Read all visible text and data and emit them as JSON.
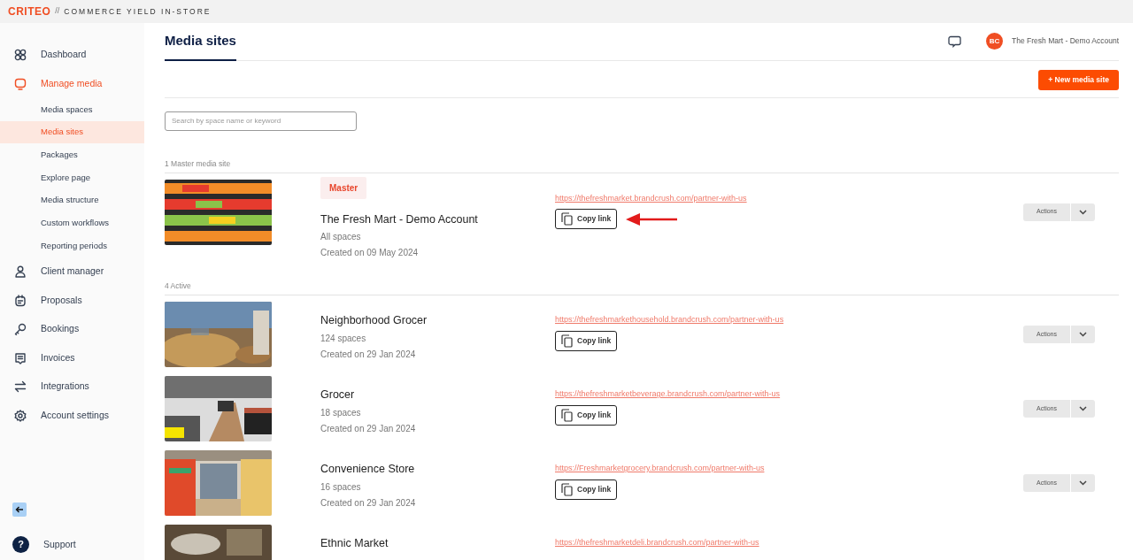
{
  "brand": {
    "logo": "CRITEO",
    "separator": "//",
    "product": "COMMERCE YIELD IN-STORE"
  },
  "sidebar": {
    "items": [
      {
        "label": "Dashboard",
        "selected": false
      },
      {
        "label": "Manage media",
        "selected": true,
        "children": [
          {
            "label": "Media spaces",
            "selected": false
          },
          {
            "label": "Media sites",
            "selected": true
          },
          {
            "label": "Packages",
            "selected": false
          },
          {
            "label": "Explore page",
            "selected": false
          },
          {
            "label": "Media structure",
            "selected": false
          },
          {
            "label": "Custom workflows",
            "selected": false
          },
          {
            "label": "Reporting periods",
            "selected": false
          }
        ]
      },
      {
        "label": "Client manager",
        "selected": false
      },
      {
        "label": "Proposals",
        "selected": false
      },
      {
        "label": "Bookings",
        "selected": false
      },
      {
        "label": "Invoices",
        "selected": false
      },
      {
        "label": "Integrations",
        "selected": false
      },
      {
        "label": "Account settings",
        "selected": false
      }
    ],
    "support": {
      "icon_text": "?",
      "label": "Support"
    }
  },
  "header": {
    "title": "Media sites",
    "user": {
      "initials": "BC",
      "name": "The Fresh Mart - Demo Account"
    }
  },
  "new_button": "+ New media site",
  "search": {
    "placeholder": "Search by space name or keyword"
  },
  "sections": [
    {
      "heading": "1 Master media site",
      "sites": [
        {
          "badge": "Master",
          "name": "The Fresh Mart - Demo Account",
          "spaces": "All spaces",
          "created": "Created on 09 May 2024",
          "url": "https://thefreshmarket.brandcrush.com/partner-with-us",
          "copy": "Copy link",
          "actions": "Actions",
          "arrow_annotation": true
        }
      ]
    },
    {
      "heading": "4 Active",
      "sites": [
        {
          "name": "Neighborhood Grocer",
          "spaces": "124 spaces",
          "created": "Created on 29 Jan 2024",
          "url": "https://thefreshmarkethousehold.brandcrush.com/partner-with-us",
          "copy": "Copy link",
          "actions": "Actions",
          "arrow_annotation": false
        },
        {
          "name": "Grocer",
          "spaces": "18 spaces",
          "created": "Created on 29 Jan 2024",
          "url": "https://thefreshmarketbeverage.brandcrush.com/partner-with-us",
          "copy": "Copy link",
          "actions": "Actions",
          "arrow_annotation": false
        },
        {
          "name": "Convenience Store",
          "spaces": "16 spaces",
          "created": "Created on 29 Jan 2024",
          "url": "https://Freshmarketgrocery.brandcrush.com/partner-with-us",
          "copy": "Copy link",
          "actions": "Actions",
          "arrow_annotation": false
        },
        {
          "name": "Ethnic Market",
          "url": "https://thefreshmarketdeli.brandcrush.com/partner-with-us",
          "arrow_annotation": false
        }
      ]
    }
  ]
}
